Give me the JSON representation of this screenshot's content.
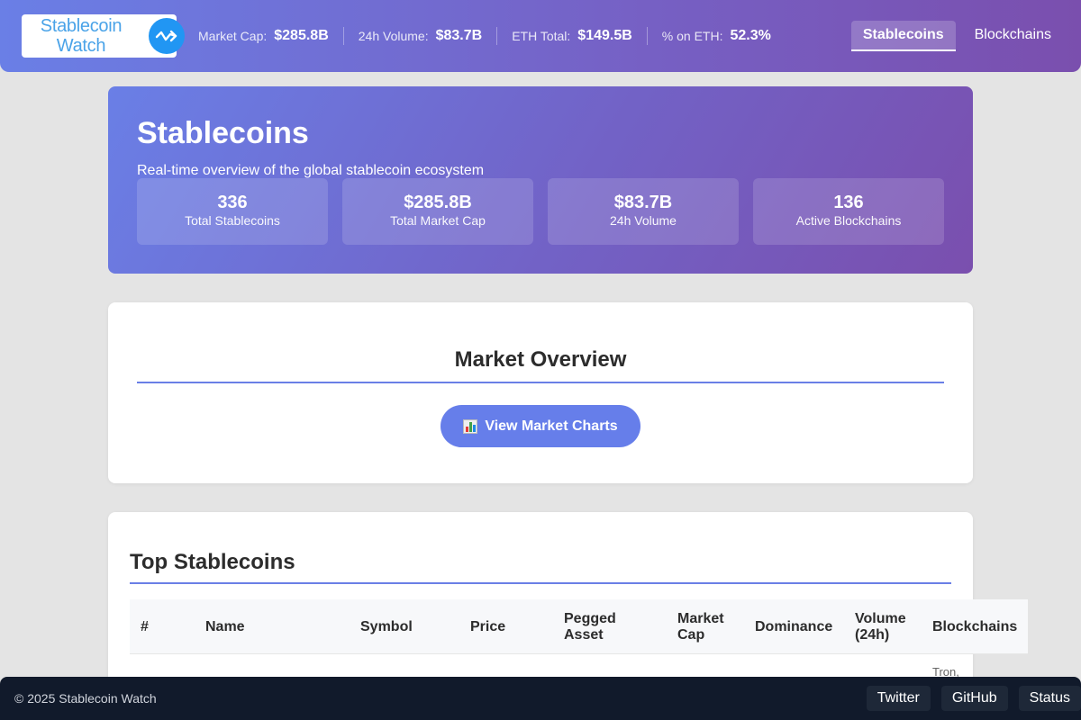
{
  "header": {
    "logo": {
      "line1": "Stablecoin",
      "line2": "Watch",
      "icon": "trend-arrow-icon"
    },
    "stats": [
      {
        "label": "Market Cap:",
        "value": "$285.8B"
      },
      {
        "label": "24h Volume:",
        "value": "$83.7B"
      },
      {
        "label": "ETH Total:",
        "value": "$149.5B"
      },
      {
        "label": "% on ETH:",
        "value": "52.3%"
      }
    ],
    "nav": [
      {
        "label": "Stablecoins",
        "active": true
      },
      {
        "label": "Blockchains",
        "active": false
      }
    ]
  },
  "hero": {
    "title": "Stablecoins",
    "subtitle": "Real-time overview of the global stablecoin ecosystem",
    "cards": [
      {
        "value": "336",
        "label": "Total Stablecoins"
      },
      {
        "value": "$285.8B",
        "label": "Total Market Cap"
      },
      {
        "value": "$83.7B",
        "label": "24h Volume"
      },
      {
        "value": "136",
        "label": "Active Blockchains"
      }
    ]
  },
  "market_overview": {
    "title": "Market Overview",
    "button_label": "View Market Charts",
    "button_icon": "bar-chart-icon"
  },
  "top_stablecoins": {
    "title": "Top Stablecoins",
    "columns": [
      "#",
      "Name",
      "Symbol",
      "Price",
      "Pegged Asset",
      "Market Cap",
      "Dominance",
      "Volume (24h)",
      "Blockchains"
    ],
    "partial_cell": "Tron,"
  },
  "footer": {
    "copyright": "© 2025 Stablecoin Watch",
    "links": [
      "Twitter",
      "GitHub",
      "Status"
    ]
  },
  "colors": {
    "accent": "#667eea",
    "gradient_start": "#6a7fe6",
    "gradient_end": "#7a4fae",
    "footer_bg": "#111a2b"
  }
}
